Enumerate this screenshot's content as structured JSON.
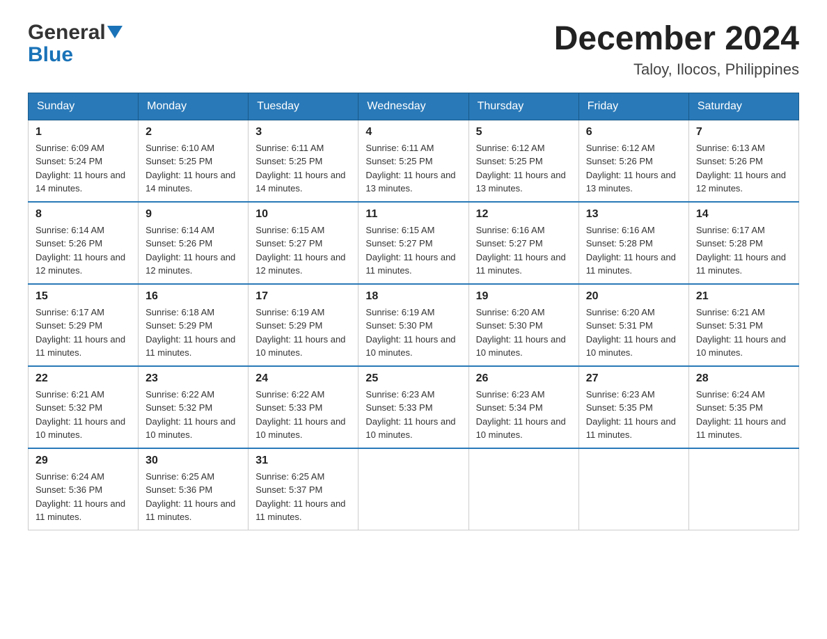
{
  "header": {
    "logo_general": "General",
    "logo_blue": "Blue",
    "month_year": "December 2024",
    "location": "Taloy, Ilocos, Philippines"
  },
  "weekdays": [
    "Sunday",
    "Monday",
    "Tuesday",
    "Wednesday",
    "Thursday",
    "Friday",
    "Saturday"
  ],
  "weeks": [
    [
      {
        "day": "1",
        "sunrise": "6:09 AM",
        "sunset": "5:24 PM",
        "daylight": "11 hours and 14 minutes."
      },
      {
        "day": "2",
        "sunrise": "6:10 AM",
        "sunset": "5:25 PM",
        "daylight": "11 hours and 14 minutes."
      },
      {
        "day": "3",
        "sunrise": "6:11 AM",
        "sunset": "5:25 PM",
        "daylight": "11 hours and 14 minutes."
      },
      {
        "day": "4",
        "sunrise": "6:11 AM",
        "sunset": "5:25 PM",
        "daylight": "11 hours and 13 minutes."
      },
      {
        "day": "5",
        "sunrise": "6:12 AM",
        "sunset": "5:25 PM",
        "daylight": "11 hours and 13 minutes."
      },
      {
        "day": "6",
        "sunrise": "6:12 AM",
        "sunset": "5:26 PM",
        "daylight": "11 hours and 13 minutes."
      },
      {
        "day": "7",
        "sunrise": "6:13 AM",
        "sunset": "5:26 PM",
        "daylight": "11 hours and 12 minutes."
      }
    ],
    [
      {
        "day": "8",
        "sunrise": "6:14 AM",
        "sunset": "5:26 PM",
        "daylight": "11 hours and 12 minutes."
      },
      {
        "day": "9",
        "sunrise": "6:14 AM",
        "sunset": "5:26 PM",
        "daylight": "11 hours and 12 minutes."
      },
      {
        "day": "10",
        "sunrise": "6:15 AM",
        "sunset": "5:27 PM",
        "daylight": "11 hours and 12 minutes."
      },
      {
        "day": "11",
        "sunrise": "6:15 AM",
        "sunset": "5:27 PM",
        "daylight": "11 hours and 11 minutes."
      },
      {
        "day": "12",
        "sunrise": "6:16 AM",
        "sunset": "5:27 PM",
        "daylight": "11 hours and 11 minutes."
      },
      {
        "day": "13",
        "sunrise": "6:16 AM",
        "sunset": "5:28 PM",
        "daylight": "11 hours and 11 minutes."
      },
      {
        "day": "14",
        "sunrise": "6:17 AM",
        "sunset": "5:28 PM",
        "daylight": "11 hours and 11 minutes."
      }
    ],
    [
      {
        "day": "15",
        "sunrise": "6:17 AM",
        "sunset": "5:29 PM",
        "daylight": "11 hours and 11 minutes."
      },
      {
        "day": "16",
        "sunrise": "6:18 AM",
        "sunset": "5:29 PM",
        "daylight": "11 hours and 11 minutes."
      },
      {
        "day": "17",
        "sunrise": "6:19 AM",
        "sunset": "5:29 PM",
        "daylight": "11 hours and 10 minutes."
      },
      {
        "day": "18",
        "sunrise": "6:19 AM",
        "sunset": "5:30 PM",
        "daylight": "11 hours and 10 minutes."
      },
      {
        "day": "19",
        "sunrise": "6:20 AM",
        "sunset": "5:30 PM",
        "daylight": "11 hours and 10 minutes."
      },
      {
        "day": "20",
        "sunrise": "6:20 AM",
        "sunset": "5:31 PM",
        "daylight": "11 hours and 10 minutes."
      },
      {
        "day": "21",
        "sunrise": "6:21 AM",
        "sunset": "5:31 PM",
        "daylight": "11 hours and 10 minutes."
      }
    ],
    [
      {
        "day": "22",
        "sunrise": "6:21 AM",
        "sunset": "5:32 PM",
        "daylight": "11 hours and 10 minutes."
      },
      {
        "day": "23",
        "sunrise": "6:22 AM",
        "sunset": "5:32 PM",
        "daylight": "11 hours and 10 minutes."
      },
      {
        "day": "24",
        "sunrise": "6:22 AM",
        "sunset": "5:33 PM",
        "daylight": "11 hours and 10 minutes."
      },
      {
        "day": "25",
        "sunrise": "6:23 AM",
        "sunset": "5:33 PM",
        "daylight": "11 hours and 10 minutes."
      },
      {
        "day": "26",
        "sunrise": "6:23 AM",
        "sunset": "5:34 PM",
        "daylight": "11 hours and 10 minutes."
      },
      {
        "day": "27",
        "sunrise": "6:23 AM",
        "sunset": "5:35 PM",
        "daylight": "11 hours and 11 minutes."
      },
      {
        "day": "28",
        "sunrise": "6:24 AM",
        "sunset": "5:35 PM",
        "daylight": "11 hours and 11 minutes."
      }
    ],
    [
      {
        "day": "29",
        "sunrise": "6:24 AM",
        "sunset": "5:36 PM",
        "daylight": "11 hours and 11 minutes."
      },
      {
        "day": "30",
        "sunrise": "6:25 AM",
        "sunset": "5:36 PM",
        "daylight": "11 hours and 11 minutes."
      },
      {
        "day": "31",
        "sunrise": "6:25 AM",
        "sunset": "5:37 PM",
        "daylight": "11 hours and 11 minutes."
      },
      null,
      null,
      null,
      null
    ]
  ],
  "labels": {
    "sunrise_prefix": "Sunrise: ",
    "sunset_prefix": "Sunset: ",
    "daylight_prefix": "Daylight: "
  }
}
